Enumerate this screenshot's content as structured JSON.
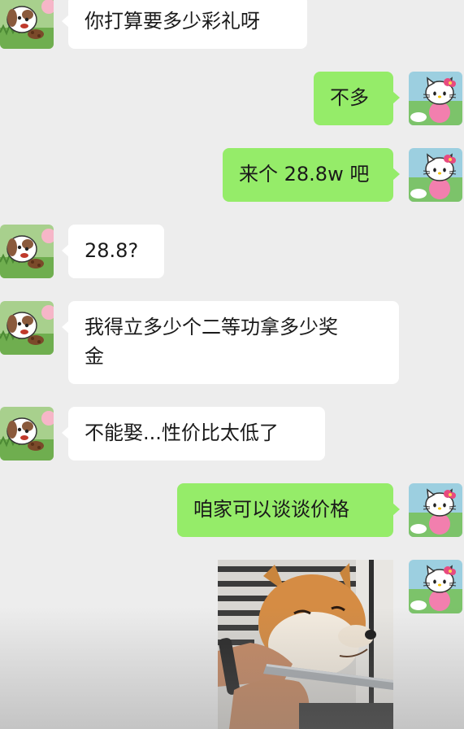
{
  "messages": [
    {
      "side": "left",
      "text": "你打算要多少彩礼呀"
    },
    {
      "side": "right",
      "text": "不多"
    },
    {
      "side": "right",
      "text": "来个 28.8w 吧"
    },
    {
      "side": "left",
      "text": "28.8?"
    },
    {
      "side": "left",
      "text": "我得立多少个二等功拿多少奖\n金"
    },
    {
      "side": "left",
      "text": "不能娶...性价比太低了"
    },
    {
      "side": "right",
      "text": "咱家可以谈谈价格"
    },
    {
      "side": "right",
      "type": "image",
      "image": "shiba-dog-knife-meme"
    }
  ],
  "avatars": {
    "left": "puppy-avatar-icon",
    "right": "hello-kitty-avatar-icon"
  },
  "colors": {
    "background": "#ededed",
    "sent_bubble": "#95ec69",
    "received_bubble": "#ffffff"
  }
}
